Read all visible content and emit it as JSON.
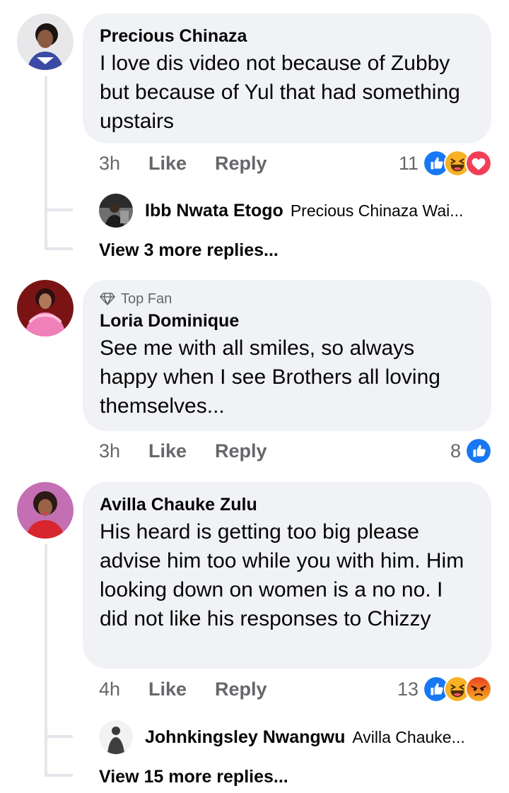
{
  "comments": [
    {
      "author": "Precious Chinaza",
      "text": "I love dis video not because of Zubby but because  of Yul that had something upstairs",
      "time": "3h",
      "like_label": "Like",
      "reply_label": "Reply",
      "reaction_count": "11",
      "reactions": [
        "like-icon",
        "haha-icon",
        "love-icon"
      ],
      "reply_preview": {
        "author": "Ibb Nwata Etogo",
        "text": "Precious Chinaza Wai..."
      },
      "view_more": "View 3 more replies..."
    },
    {
      "badge": "Top Fan",
      "author": "Loria Dominique",
      "text": "See me with all smiles, so always happy when I see Brothers all loving themselves...",
      "time": "3h",
      "like_label": "Like",
      "reply_label": "Reply",
      "reaction_count": "8",
      "reactions": [
        "like-icon"
      ]
    },
    {
      "author": "Avilla Chauke Zulu",
      "text": "His heard is getting too big please advise him too while you with him. Him looking down on women is a no no. I did not like his responses to Chizzy",
      "time": "4h",
      "like_label": "Like",
      "reply_label": "Reply",
      "reaction_count": "13",
      "reactions": [
        "like-icon",
        "haha-icon",
        "angry-icon"
      ],
      "reply_preview": {
        "author": "Johnkingsley Nwangwu",
        "text": "Avilla Chauke..."
      },
      "view_more": "View 15 more replies..."
    }
  ],
  "colors": {
    "bubble": "#f0f2f5",
    "secondary_text": "#65676b",
    "like_blue": "#1877f2",
    "love_red": "#f33e58",
    "haha_yellow": "#f7b125",
    "angry_orange": "#e9710f",
    "thread_line": "#e4e6eb"
  }
}
